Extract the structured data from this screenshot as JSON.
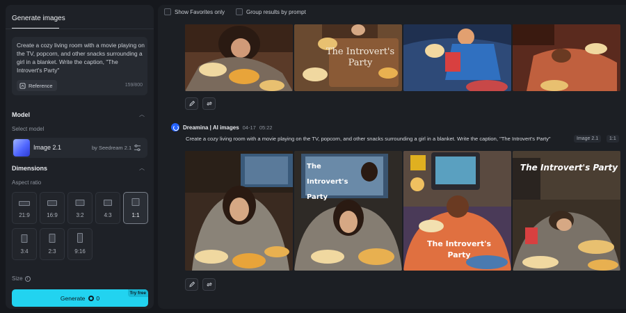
{
  "sidebar": {
    "tab_label": "Generate images",
    "prompt": "Create a cozy living room with a movie playing on the TV, popcorn, and other snacks surrounding a girl in a blanket. Write the caption, \"The Introvert's Party\"",
    "reference_label": "Reference",
    "char_count": "159/800",
    "model_section": "Model",
    "select_model_label": "Select model",
    "model_name": "Image 2.1",
    "model_provider": "by Seedream 2.1",
    "dimensions_section": "Dimensions",
    "aspect_ratio_label": "Aspect ratio",
    "aspect_ratios": [
      "21:9",
      "16:9",
      "3:2",
      "4:3",
      "1:1",
      "3:4",
      "2:3",
      "9:16"
    ],
    "selected_ratio": "1:1",
    "size_label": "Size",
    "generate_label": "Generate",
    "generate_cost": "0",
    "try_free_label": "Try free",
    "accent_color": "#22d3f0"
  },
  "filters": {
    "show_favorites": "Show Favorites only",
    "group_by_prompt": "Group results by prompt"
  },
  "generation": {
    "source": "Dreamina | AI images",
    "date": "04-17",
    "time": "05:22",
    "prompt": "Create a cozy living room with a movie playing on the TV, popcorn, and other snacks surrounding a girl in a blanket. Write the caption, \"The Introvert's Party\"",
    "model_tag": "Image 2.1",
    "ratio_tag": "1:1",
    "captions": [
      "The Introvert's Party",
      "The Introvert's Party",
      "The Introvert's Party"
    ]
  },
  "previous": {
    "caption": "The Introvert's Party"
  }
}
